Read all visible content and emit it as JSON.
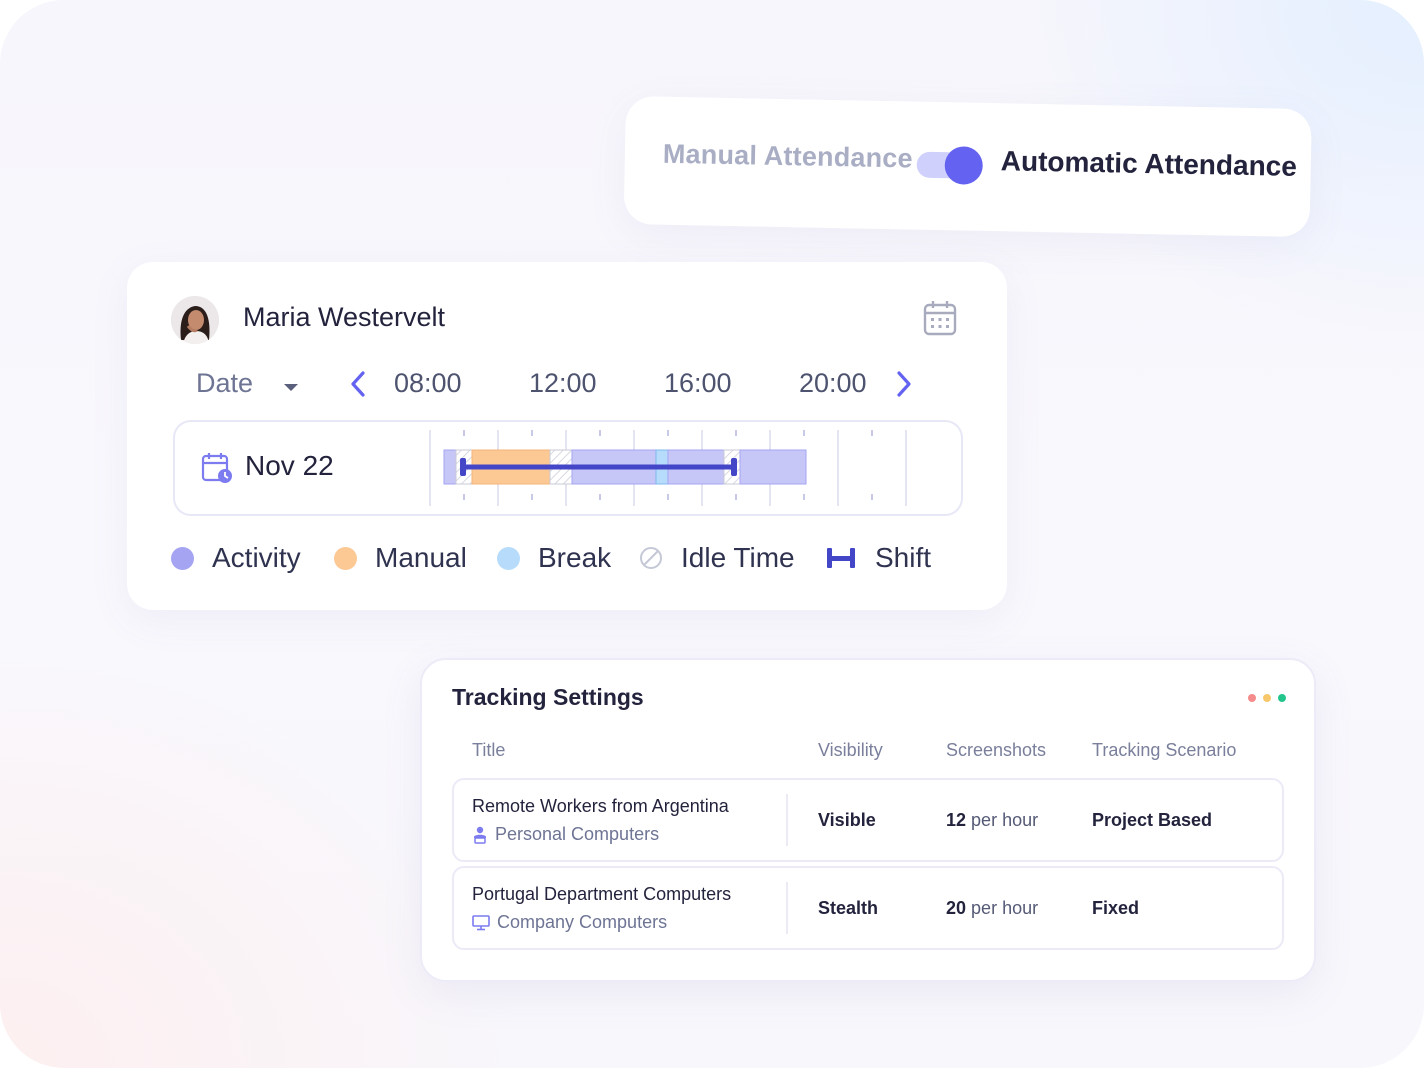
{
  "attendance_toggle": {
    "left_label": "Manual Attendance",
    "right_label": "Automatic Attendance",
    "state": "automatic",
    "accent": "#6462f0"
  },
  "timeline": {
    "user_name": "Maria Westervelt",
    "date_filter_label": "Date",
    "hours": [
      "08:00",
      "12:00",
      "16:00",
      "20:00"
    ],
    "row_date": "Nov 22",
    "legend": [
      {
        "label": "Activity",
        "color": "#a5a4f3"
      },
      {
        "label": "Manual",
        "color": "#fcc894"
      },
      {
        "label": "Break",
        "color": "#b7dcfb"
      },
      {
        "label": "Idle Time",
        "color": "#c9cbd6"
      },
      {
        "label": "Shift",
        "color": "#4446c8"
      }
    ]
  },
  "tracking_settings": {
    "title": "Tracking Settings",
    "columns": [
      "Title",
      "Visibility",
      "Screenshots",
      "Tracking Scenario"
    ],
    "rows": [
      {
        "title": "Remote Workers from Argentina",
        "subtitle": "Personal Computers",
        "subtitle_icon": "person-icon",
        "visibility": "Visible",
        "screenshots_count": "12",
        "screenshots_unit": "per hour",
        "scenario": "Project Based"
      },
      {
        "title": "Portugal Department Computers",
        "subtitle": "Company Computers",
        "subtitle_icon": "monitor-icon",
        "visibility": "Stealth",
        "screenshots_count": "20",
        "screenshots_unit": "per hour",
        "scenario": "Fixed"
      }
    ],
    "window_dot_colors": [
      "#f58b8b",
      "#f7c76b",
      "#22c58b"
    ]
  }
}
